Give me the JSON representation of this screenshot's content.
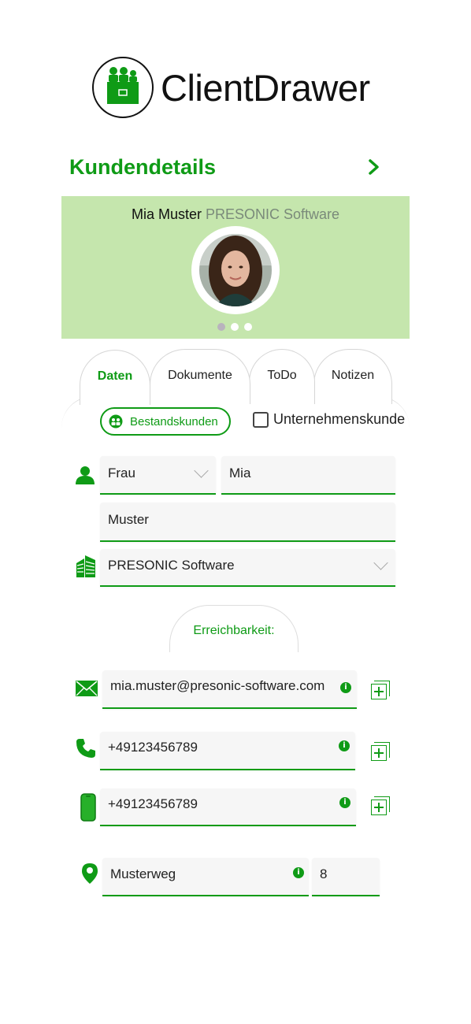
{
  "app": {
    "name": "ClientDrawer"
  },
  "header": {
    "title": "Kundendetails"
  },
  "banner": {
    "person": "Mia Muster",
    "company": "PRESONIC Software",
    "active_dot": 0,
    "dots": 3
  },
  "tabs": [
    {
      "label": "Daten",
      "active": true
    },
    {
      "label": "Dokumente",
      "active": false
    },
    {
      "label": "ToDo",
      "active": false
    },
    {
      "label": "Notizen",
      "active": false
    }
  ],
  "status": {
    "label": "Bestandskunden"
  },
  "business": {
    "label": "Unternehmenskunde",
    "checked": false
  },
  "person": {
    "salutation": "Frau",
    "first_name": "Mia",
    "last_name": "Muster",
    "company": "PRESONIC Software"
  },
  "contact": {
    "section_title": "Erreichbarkeit:",
    "email": "mia.muster@presonic-software.com",
    "phone": "+49123456789",
    "mobile": "+49123456789"
  },
  "address": {
    "street": "Musterweg",
    "number": "8"
  },
  "colors": {
    "accent": "#0f9b16",
    "banner": "#c5e6ad"
  }
}
